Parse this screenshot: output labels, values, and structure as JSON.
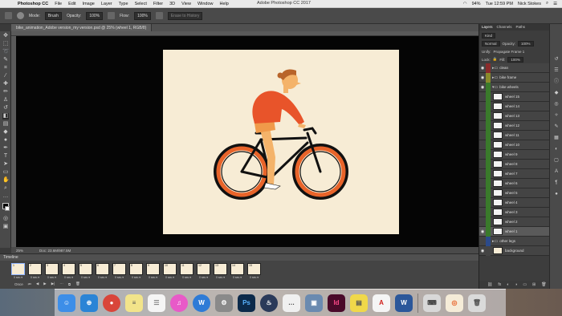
{
  "menubar": {
    "app": "Photoshop CC",
    "items": [
      "File",
      "Edit",
      "Image",
      "Layer",
      "Type",
      "Select",
      "Filter",
      "3D",
      "View",
      "Window",
      "Help"
    ],
    "window_title": "Adobe Photoshop CC 2017",
    "battery": "94%",
    "time": "Tue 12:59 PM",
    "user": "Nick Stokes"
  },
  "options": {
    "mode_label": "Mode:",
    "mode_value": "Brush",
    "opacity_label": "Opacity:",
    "opacity_value": "100%",
    "flow_label": "Flow:",
    "flow_value": "100%",
    "erase_history": "Erase to History"
  },
  "document": {
    "tab_label": "bike_animation_Adobe version_my version.psd @ 25% (wheel 1, RGB/8)"
  },
  "status": {
    "zoom": "25%",
    "doc_size": "Doc: 23.6M/987.5M"
  },
  "timeline": {
    "title": "Timeline",
    "frames": [
      {
        "num": "1",
        "dur": "0 sec.▾"
      },
      {
        "num": "2",
        "dur": "0 sec.▾"
      },
      {
        "num": "3",
        "dur": "0 sec.▾"
      },
      {
        "num": "4",
        "dur": "0 sec.▾"
      },
      {
        "num": "5",
        "dur": "0 sec.▾"
      },
      {
        "num": "6",
        "dur": "0 sec.▾"
      },
      {
        "num": "7",
        "dur": "0 sec.▾"
      },
      {
        "num": "8",
        "dur": "0 sec.▾"
      },
      {
        "num": "9",
        "dur": "0 sec.▾"
      },
      {
        "num": "10",
        "dur": "0 sec.▾"
      },
      {
        "num": "11",
        "dur": "0 sec.▾"
      },
      {
        "num": "12",
        "dur": "0 sec.▾"
      },
      {
        "num": "13",
        "dur": "0 sec.▾"
      },
      {
        "num": "14",
        "dur": "0 sec.▾"
      },
      {
        "num": "15",
        "dur": "0 sec.▾"
      }
    ],
    "loop": "Once"
  },
  "panel": {
    "tabs": [
      "Layers",
      "Channels",
      "Paths"
    ],
    "kind": "Kind",
    "blend": "Normal",
    "opacity_label": "Opacity:",
    "opacity_value": "100%",
    "unify": "Unify:",
    "propagate": "Propagate Frame 1",
    "lock": "Lock:",
    "fill_label": "Fill:",
    "fill_value": "100%"
  },
  "layers": [
    {
      "name": "clean",
      "type": "folder",
      "color": "#8a2b2b"
    },
    {
      "name": "bike frame",
      "type": "folder",
      "color": "#8a8a2b"
    },
    {
      "name": "bike wheels",
      "type": "folder",
      "color": "#3a7a2b"
    },
    {
      "name": "wheel 15",
      "type": "layer",
      "color": "#3a7a2b"
    },
    {
      "name": "wheel 14",
      "type": "layer",
      "color": "#3a7a2b"
    },
    {
      "name": "wheel 13",
      "type": "layer",
      "color": "#3a7a2b"
    },
    {
      "name": "wheel 12",
      "type": "layer",
      "color": "#3a7a2b"
    },
    {
      "name": "wheel 11",
      "type": "layer",
      "color": "#3a7a2b"
    },
    {
      "name": "wheel 10",
      "type": "layer",
      "color": "#3a7a2b"
    },
    {
      "name": "wheel 9",
      "type": "layer",
      "color": "#3a7a2b"
    },
    {
      "name": "wheel 8",
      "type": "layer",
      "color": "#3a7a2b"
    },
    {
      "name": "wheel 7",
      "type": "layer",
      "color": "#3a7a2b"
    },
    {
      "name": "wheel 6",
      "type": "layer",
      "color": "#3a7a2b"
    },
    {
      "name": "wheel 5",
      "type": "layer",
      "color": "#3a7a2b"
    },
    {
      "name": "wheel 4",
      "type": "layer",
      "color": "#3a7a2b"
    },
    {
      "name": "wheel 3",
      "type": "layer",
      "color": "#3a7a2b"
    },
    {
      "name": "wheel 2",
      "type": "layer",
      "color": "#3a7a2b"
    },
    {
      "name": "wheel 1",
      "type": "layer",
      "color": "#3a7a2b",
      "selected": true
    },
    {
      "name": "other legs",
      "type": "folder",
      "color": "#2b4a8a"
    },
    {
      "name": "background",
      "type": "layer",
      "color": "#444444",
      "locked": true
    }
  ],
  "dock": [
    {
      "name": "Finder",
      "color": "#3d8ee8",
      "glyph": "☺"
    },
    {
      "name": "Safari",
      "color": "#2a84d6",
      "glyph": "⊕"
    },
    {
      "name": "Chrome",
      "color": "#d9453a",
      "glyph": "●"
    },
    {
      "name": "Notes",
      "color": "#f2e48a",
      "glyph": "≡"
    },
    {
      "name": "Reminders",
      "color": "#f5f5f5",
      "glyph": "☰"
    },
    {
      "name": "iTunes",
      "color": "#e85ac8",
      "glyph": "♫"
    },
    {
      "name": "Wunderlist",
      "color": "#2e7bd6",
      "glyph": "W"
    },
    {
      "name": "System Preferences",
      "color": "#8a8a8a",
      "glyph": "⚙"
    },
    {
      "name": "Photoshop",
      "color": "#0c2a4a",
      "glyph": "Ps"
    },
    {
      "name": "Steam",
      "color": "#2a3a5a",
      "glyph": "♨"
    },
    {
      "name": "Messenger",
      "color": "#f0f0f0",
      "glyph": "…"
    },
    {
      "name": "Preview",
      "color": "#6a8ab0",
      "glyph": "▣"
    },
    {
      "name": "InDesign",
      "color": "#4a0a2a",
      "glyph": "Id"
    },
    {
      "name": "Stickies",
      "color": "#f0d84a",
      "glyph": "▤"
    },
    {
      "name": "Acrobat",
      "color": "#f5f5f5",
      "glyph": "A"
    },
    {
      "name": "Word",
      "color": "#2b579a",
      "glyph": "W"
    },
    {
      "name": "Keyboard",
      "color": "#d8d8d8",
      "glyph": "⌨"
    },
    {
      "name": "Bike preview",
      "color": "#f5ecd8",
      "glyph": "◎"
    },
    {
      "name": "Trash",
      "color": "#dadada",
      "glyph": "🗑"
    }
  ]
}
